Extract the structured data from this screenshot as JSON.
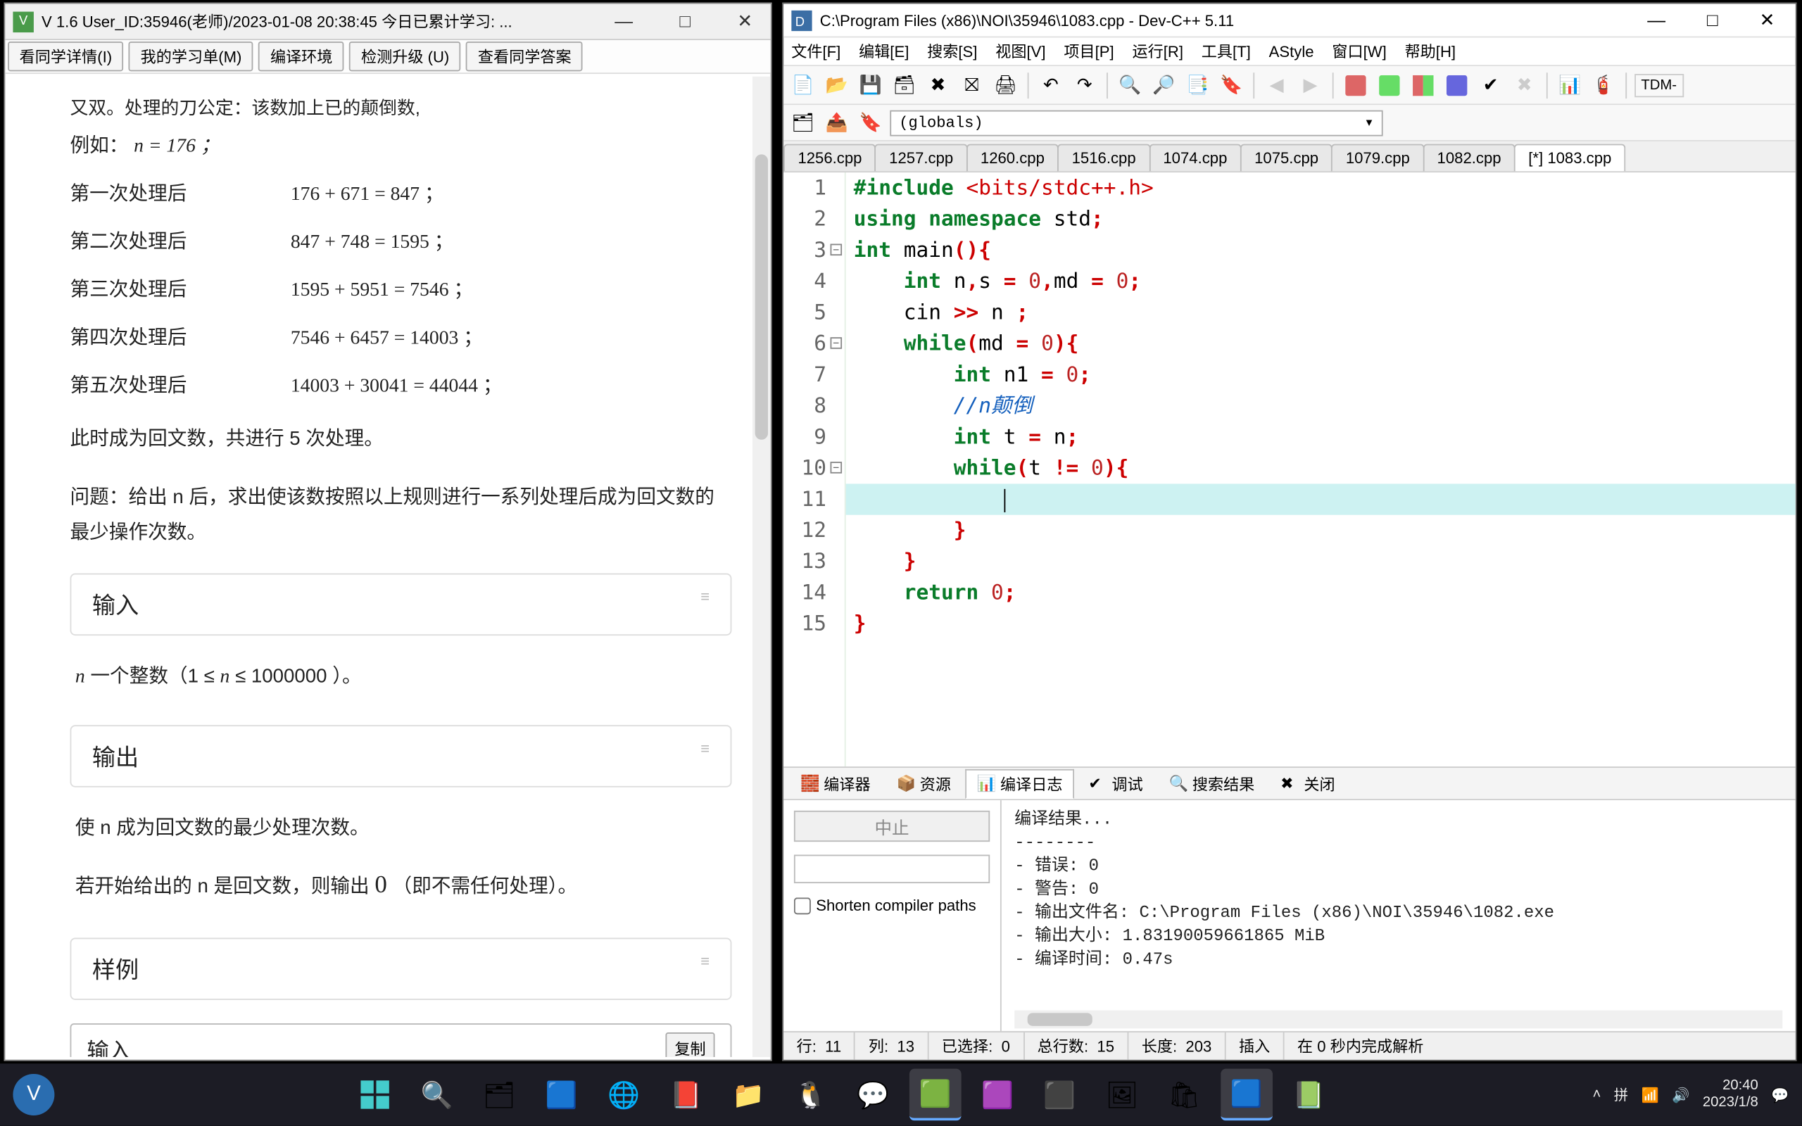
{
  "left_window": {
    "title": "V 1.6 User_ID:35946(老师)/2023-01-08 20:38:45 今日已累计学习: ...",
    "toolbar": [
      "看同学详情(I)",
      "我的学习单(M)",
      "编译环境",
      "检测升级 (U)",
      "查看同学答案"
    ],
    "frag_top": "又双。处理的刀公定：该数加上已的颠倒数,",
    "example_label": "例如：",
    "example_expr": "n = 176 ；",
    "rows": [
      {
        "label": "第一次处理后",
        "expr": "176 + 671 = 847 ；"
      },
      {
        "label": "第二次处理后",
        "expr": "847 + 748 = 1595 ；"
      },
      {
        "label": "第三次处理后",
        "expr": "1595 + 5951 = 7546 ；"
      },
      {
        "label": "第四次处理后",
        "expr": "7546 + 6457 = 14003 ；"
      },
      {
        "label": "第五次处理后",
        "expr": "14003 + 30041 = 44044 ；"
      }
    ],
    "para1": "此时成为回文数，共进行 5 次处理。",
    "para2": "问题：给出 n 后，求出使该数按照以上规则进行一系列处理后成为回文数的最少操作次数。",
    "sec_input": "输入",
    "input_body": "n 一个整数（1 ≤ n ≤ 1000000 ）。",
    "sec_output": "输出",
    "output_body1": "使 n 成为回文数的最少处理次数。",
    "output_body2a": "若开始给出的 n 是回文数，则输出  ",
    "output_body2_zero": "0",
    "output_body2b": "   （即不需任何处理）。",
    "sec_sample": "样例",
    "sample_label": "输入",
    "copy": "复制"
  },
  "right_window": {
    "title": "C:\\Program Files (x86)\\NOI\\35946\\1083.cpp - Dev-C++ 5.11",
    "menu": [
      "文件[F]",
      "编辑[E]",
      "搜索[S]",
      "视图[V]",
      "项目[P]",
      "运行[R]",
      "工具[T]",
      "AStyle",
      "窗口[W]",
      "帮助[H]"
    ],
    "combo": "(globals)",
    "tabs": [
      "1256.cpp",
      "1257.cpp",
      "1260.cpp",
      "1516.cpp",
      "1074.cpp",
      "1075.cpp",
      "1079.cpp",
      "1082.cpp",
      "[*] 1083.cpp"
    ],
    "code": [
      "#include <bits/stdc++.h>",
      "using namespace std;",
      "int main(){",
      "    int n,s = 0,md = 0;",
      "    cin >> n ;",
      "    while(md = 0){",
      "        int n1 = 0;",
      "        //n颠倒",
      "        int t = n;",
      "        while(t != 0){",
      "            ",
      "        }",
      "    }",
      "    return 0;",
      "}"
    ],
    "bottom_tabs": [
      "编译器",
      "资源",
      "编译日志",
      "调试",
      "搜索结果",
      "关闭"
    ],
    "bp_abort": "中止",
    "bp_shorten": "Shorten compiler paths",
    "bp_lines": [
      "编译结果...",
      "--------",
      "- 错误: 0",
      "- 警告: 0",
      "- 输出文件名: C:\\Program Files (x86)\\NOI\\35946\\1082.exe",
      "- 输出大小: 1.83190059661865 MiB",
      "- 编译时间: 0.47s"
    ],
    "status": {
      "line_lbl": "行:",
      "line": "11",
      "col_lbl": "列:",
      "col": "13",
      "sel_lbl": "已选择:",
      "sel": "0",
      "tot_lbl": "总行数:",
      "tot": "15",
      "len_lbl": "长度:",
      "len": "203",
      "ins": "插入",
      "done": "在 0 秒内完成解析"
    },
    "tdm": "TDM-"
  },
  "taskbar": {
    "time": "20:40",
    "date": "2023/1/8"
  }
}
